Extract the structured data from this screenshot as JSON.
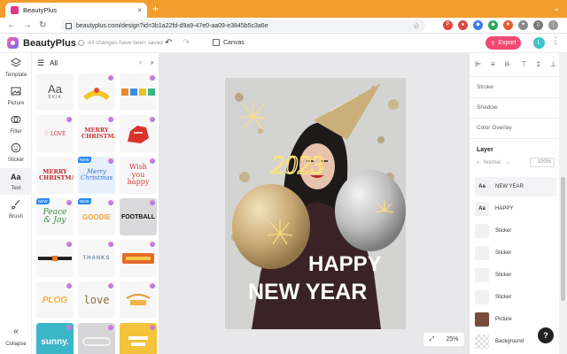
{
  "browser": {
    "tab_title": "BeautyPlus",
    "tab_close": "×",
    "new_tab": "+",
    "url": "beautyplus.com/design?id=3b1a22fd-d9a9-47e0-aa09-e3845b5c3a6e"
  },
  "header": {
    "app_name": "BeautyPlus",
    "save_status": "All changes have been saved",
    "canvas_label": "Canvas",
    "export_label": "Export",
    "avatar_initial": "L"
  },
  "rail": {
    "items": [
      {
        "label": "Template"
      },
      {
        "label": "Picture"
      },
      {
        "label": "Filter"
      },
      {
        "label": "Sticker"
      },
      {
        "label": "Text"
      },
      {
        "label": "Brush"
      }
    ],
    "collapse_label": "Collapse"
  },
  "library": {
    "category": "All",
    "tiles": [
      "Aa",
      "BKIA",
      "",
      "",
      "♡ LOVE",
      "MERRY CHRISTMAS",
      "",
      "MERRY CHRISTMAS",
      "Merry Christmas",
      "Wish you happy",
      "Peace & Joy",
      "GOODIE",
      "FOOTBALL",
      "",
      "THANKS",
      "",
      "PLOG",
      "love",
      "",
      "sunny.",
      "",
      "",
      "NEW",
      "NEW",
      "NEW"
    ]
  },
  "poster": {
    "headline_line1": "HAPPY",
    "headline_line2": "NEW YEAR",
    "year": "2023"
  },
  "zoom": {
    "value": "25%"
  },
  "panel": {
    "stroke": "Stroke",
    "shadow": "Shadow",
    "color_overlay": "Color Overlay",
    "layer_title": "Layer",
    "blend_mode": "Normal",
    "opacity": "100%",
    "layers": [
      {
        "thumb": "Aa",
        "name": "NEW YEAR"
      },
      {
        "thumb": "Aa",
        "name": "HAPPY"
      },
      {
        "thumb": "",
        "name": "Sticker"
      },
      {
        "thumb": "",
        "name": "Sticker"
      },
      {
        "thumb": "",
        "name": "Sticker"
      },
      {
        "thumb": "",
        "name": "Sticker"
      },
      {
        "thumb": "",
        "name": "Picture"
      },
      {
        "thumb": "",
        "name": "Background"
      }
    ]
  },
  "help": "?",
  "colors": {
    "browser_tab": "#f29d2e",
    "export": "#f04a73",
    "avatar": "#3ec1c9",
    "stage_bg": "#e8e8ea"
  }
}
